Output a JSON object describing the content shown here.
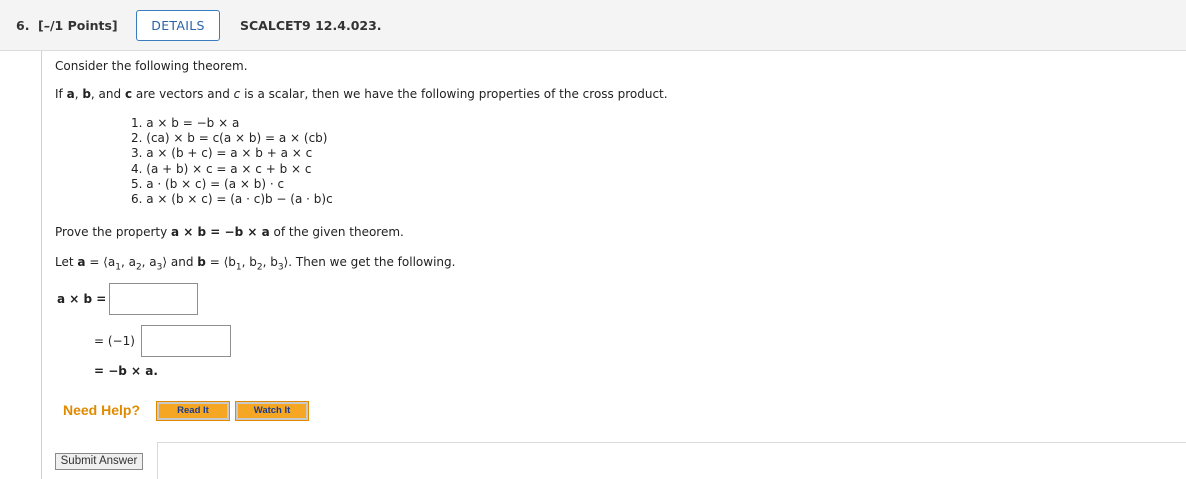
{
  "header": {
    "question_number": "6.",
    "points": "[–/1 Points]",
    "details_label": "DETAILS",
    "assignment_code": "SCALCET9 12.4.023."
  },
  "problem": {
    "intro": "Consider the following theorem.",
    "theorem_statement": {
      "p1": "If ",
      "a": "a",
      "p2": ", ",
      "b": "b",
      "p3": ", and ",
      "c": "c",
      "p4": " are vectors and ",
      "c_scalar": "c",
      "p5": " is a scalar, then we have the following properties of the cross product."
    },
    "properties": [
      "1. a × b = −b × a",
      "2. (ca) × b = c(a × b) = a × (cb)",
      "3. a × (b + c) = a × b + a × c",
      "4. (a + b) × c = a × c + b × c",
      "5. a · (b × c) = (a × b) · c",
      "6. a × (b × c) = (a · c)b − (a · b)c"
    ],
    "prove": {
      "p1": "Prove the property ",
      "expr": "a × b = −b × a",
      "p2": " of the given theorem."
    },
    "let": {
      "p1": "Let ",
      "a": "a",
      "eq_a": " = ⟨a",
      "a_sub1": "1",
      "a_mid1": ", a",
      "a_sub2": "2",
      "a_mid2": ", a",
      "a_sub3": "3",
      "a_end": "⟩",
      "and": " and ",
      "b": "b",
      "eq_b": " = ⟨b",
      "b_sub1": "1",
      "b_mid1": ", b",
      "b_sub2": "2",
      "b_mid2": ", b",
      "b_sub3": "3",
      "b_end": "⟩",
      "p2": ". Then we get the following."
    },
    "step1_label": "a × b  =",
    "step2_label": "= (−1)",
    "step3_label": "= −b × a."
  },
  "inputs": {
    "answer1_value": "",
    "answer2_value": ""
  },
  "help": {
    "need_help": "Need Help?",
    "read_it": "Read It",
    "watch_it": "Watch It"
  },
  "actions": {
    "submit_label": "Submit Answer"
  },
  "colors": {
    "details_border": "#3b7bbf",
    "need_help": "#e08a00",
    "help_button_bg": "#f5a623"
  }
}
